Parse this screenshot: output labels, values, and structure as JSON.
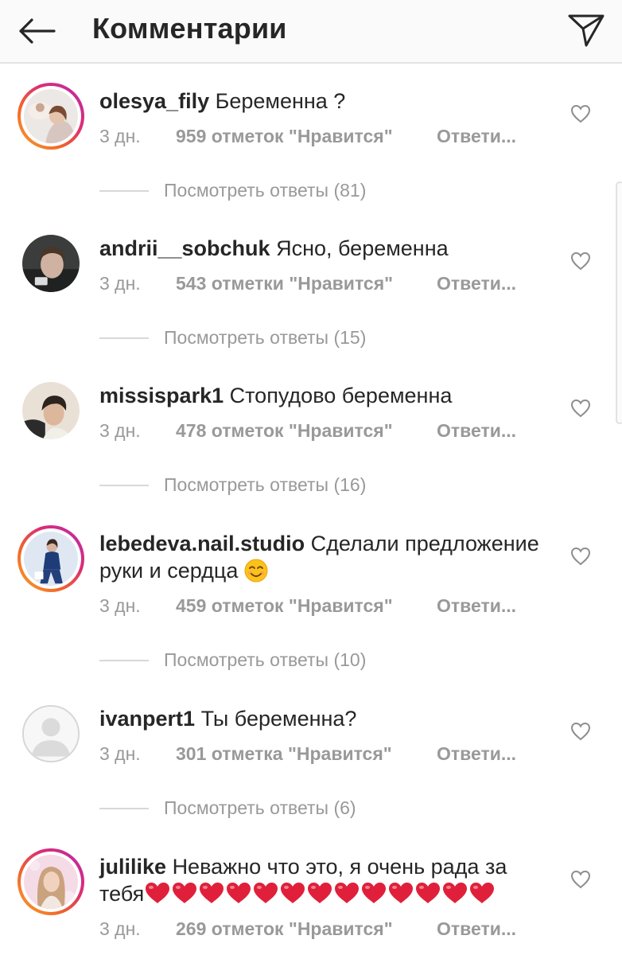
{
  "header": {
    "title": "Комментарии",
    "back_icon": "arrow-left-icon",
    "send_icon": "paper-plane-icon"
  },
  "comments": [
    {
      "username": "olesya_fily",
      "text": "Беременна ?",
      "time": "3 дн.",
      "likes": "959 отметок \"Нравится\"",
      "reply": "Ответи...",
      "replies": "Посмотреть ответы (81)",
      "story_ring": true
    },
    {
      "username": "andrii__sobchuk",
      "text": "Ясно, беременна",
      "time": "3 дн.",
      "likes": "543 отметки \"Нравится\"",
      "reply": "Ответи...",
      "replies": "Посмотреть ответы (15)",
      "story_ring": false
    },
    {
      "username": "missispark1",
      "text": "Стопудово беременна",
      "time": "3 дн.",
      "likes": "478 отметок \"Нравится\"",
      "reply": "Ответи...",
      "replies": "Посмотреть ответы (16)",
      "story_ring": false
    },
    {
      "username": "lebedeva.nail.studio",
      "text": "Сделали предложение руки и сердца",
      "emoji": "smiling-face-emoji",
      "time": "3 дн.",
      "likes": "459 отметок \"Нравится\"",
      "reply": "Ответи...",
      "replies": "Посмотреть ответы (10)",
      "story_ring": true
    },
    {
      "username": "ivanpert1",
      "text": "Ты беременна?",
      "time": "3 дн.",
      "likes": "301 отметка \"Нравится\"",
      "reply": "Ответи...",
      "replies": "Посмотреть ответы (6)",
      "story_ring": false
    },
    {
      "username": "julilike",
      "text": "Неважно что это, я очень рада за тебя",
      "emoji": "red-heart-emoji",
      "emoji_count": 13,
      "time": "3 дн.",
      "likes": "269 отметок \"Нравится\"",
      "reply": "Ответи...",
      "story_ring": true
    }
  ],
  "colors": {
    "text": "#262626",
    "muted": "#999999",
    "heart": "#e0203a",
    "story_gradient": [
      "#f9a52c",
      "#dc2d74",
      "#b62cb0"
    ]
  }
}
